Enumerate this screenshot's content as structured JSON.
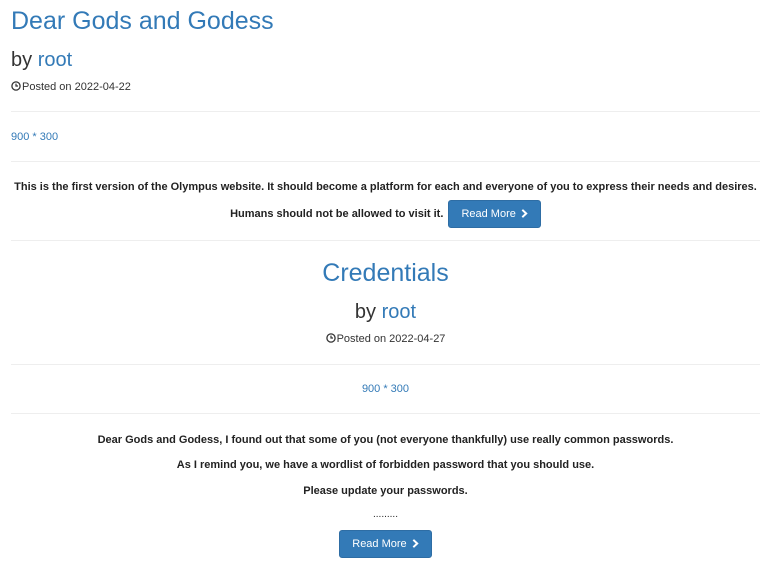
{
  "posts": [
    {
      "title": "Dear Gods and Godess",
      "by_prefix": "by",
      "author": "root",
      "posted_label": "Posted on 2022-04-22",
      "image_placeholder": "900 * 300",
      "excerpt": "This is the first version of the Olympus website. It should become a platform for each and everyone of you to express their needs and desires. Humans should not be allowed to visit it.",
      "read_more": "Read More"
    },
    {
      "title": "Credentials",
      "by_prefix": "by",
      "author": "root",
      "posted_label": "Posted on 2022-04-27",
      "image_placeholder": "900 * 300",
      "paragraphs": [
        "Dear Gods and Godess, I found out that some of you (not everyone thankfully) use really common passwords.",
        "As I remind you, we have a wordlist of forbidden password that you should use.",
        "Please update your passwords.",
        "........."
      ],
      "read_more": "Read More"
    }
  ],
  "icons": {
    "posted": "clock-icon",
    "read_more": "chevron-right-icon"
  },
  "colors": {
    "link": "#337ab7",
    "button_bg": "#337ab7",
    "separator": "#eeeeee",
    "text": "#333333"
  }
}
